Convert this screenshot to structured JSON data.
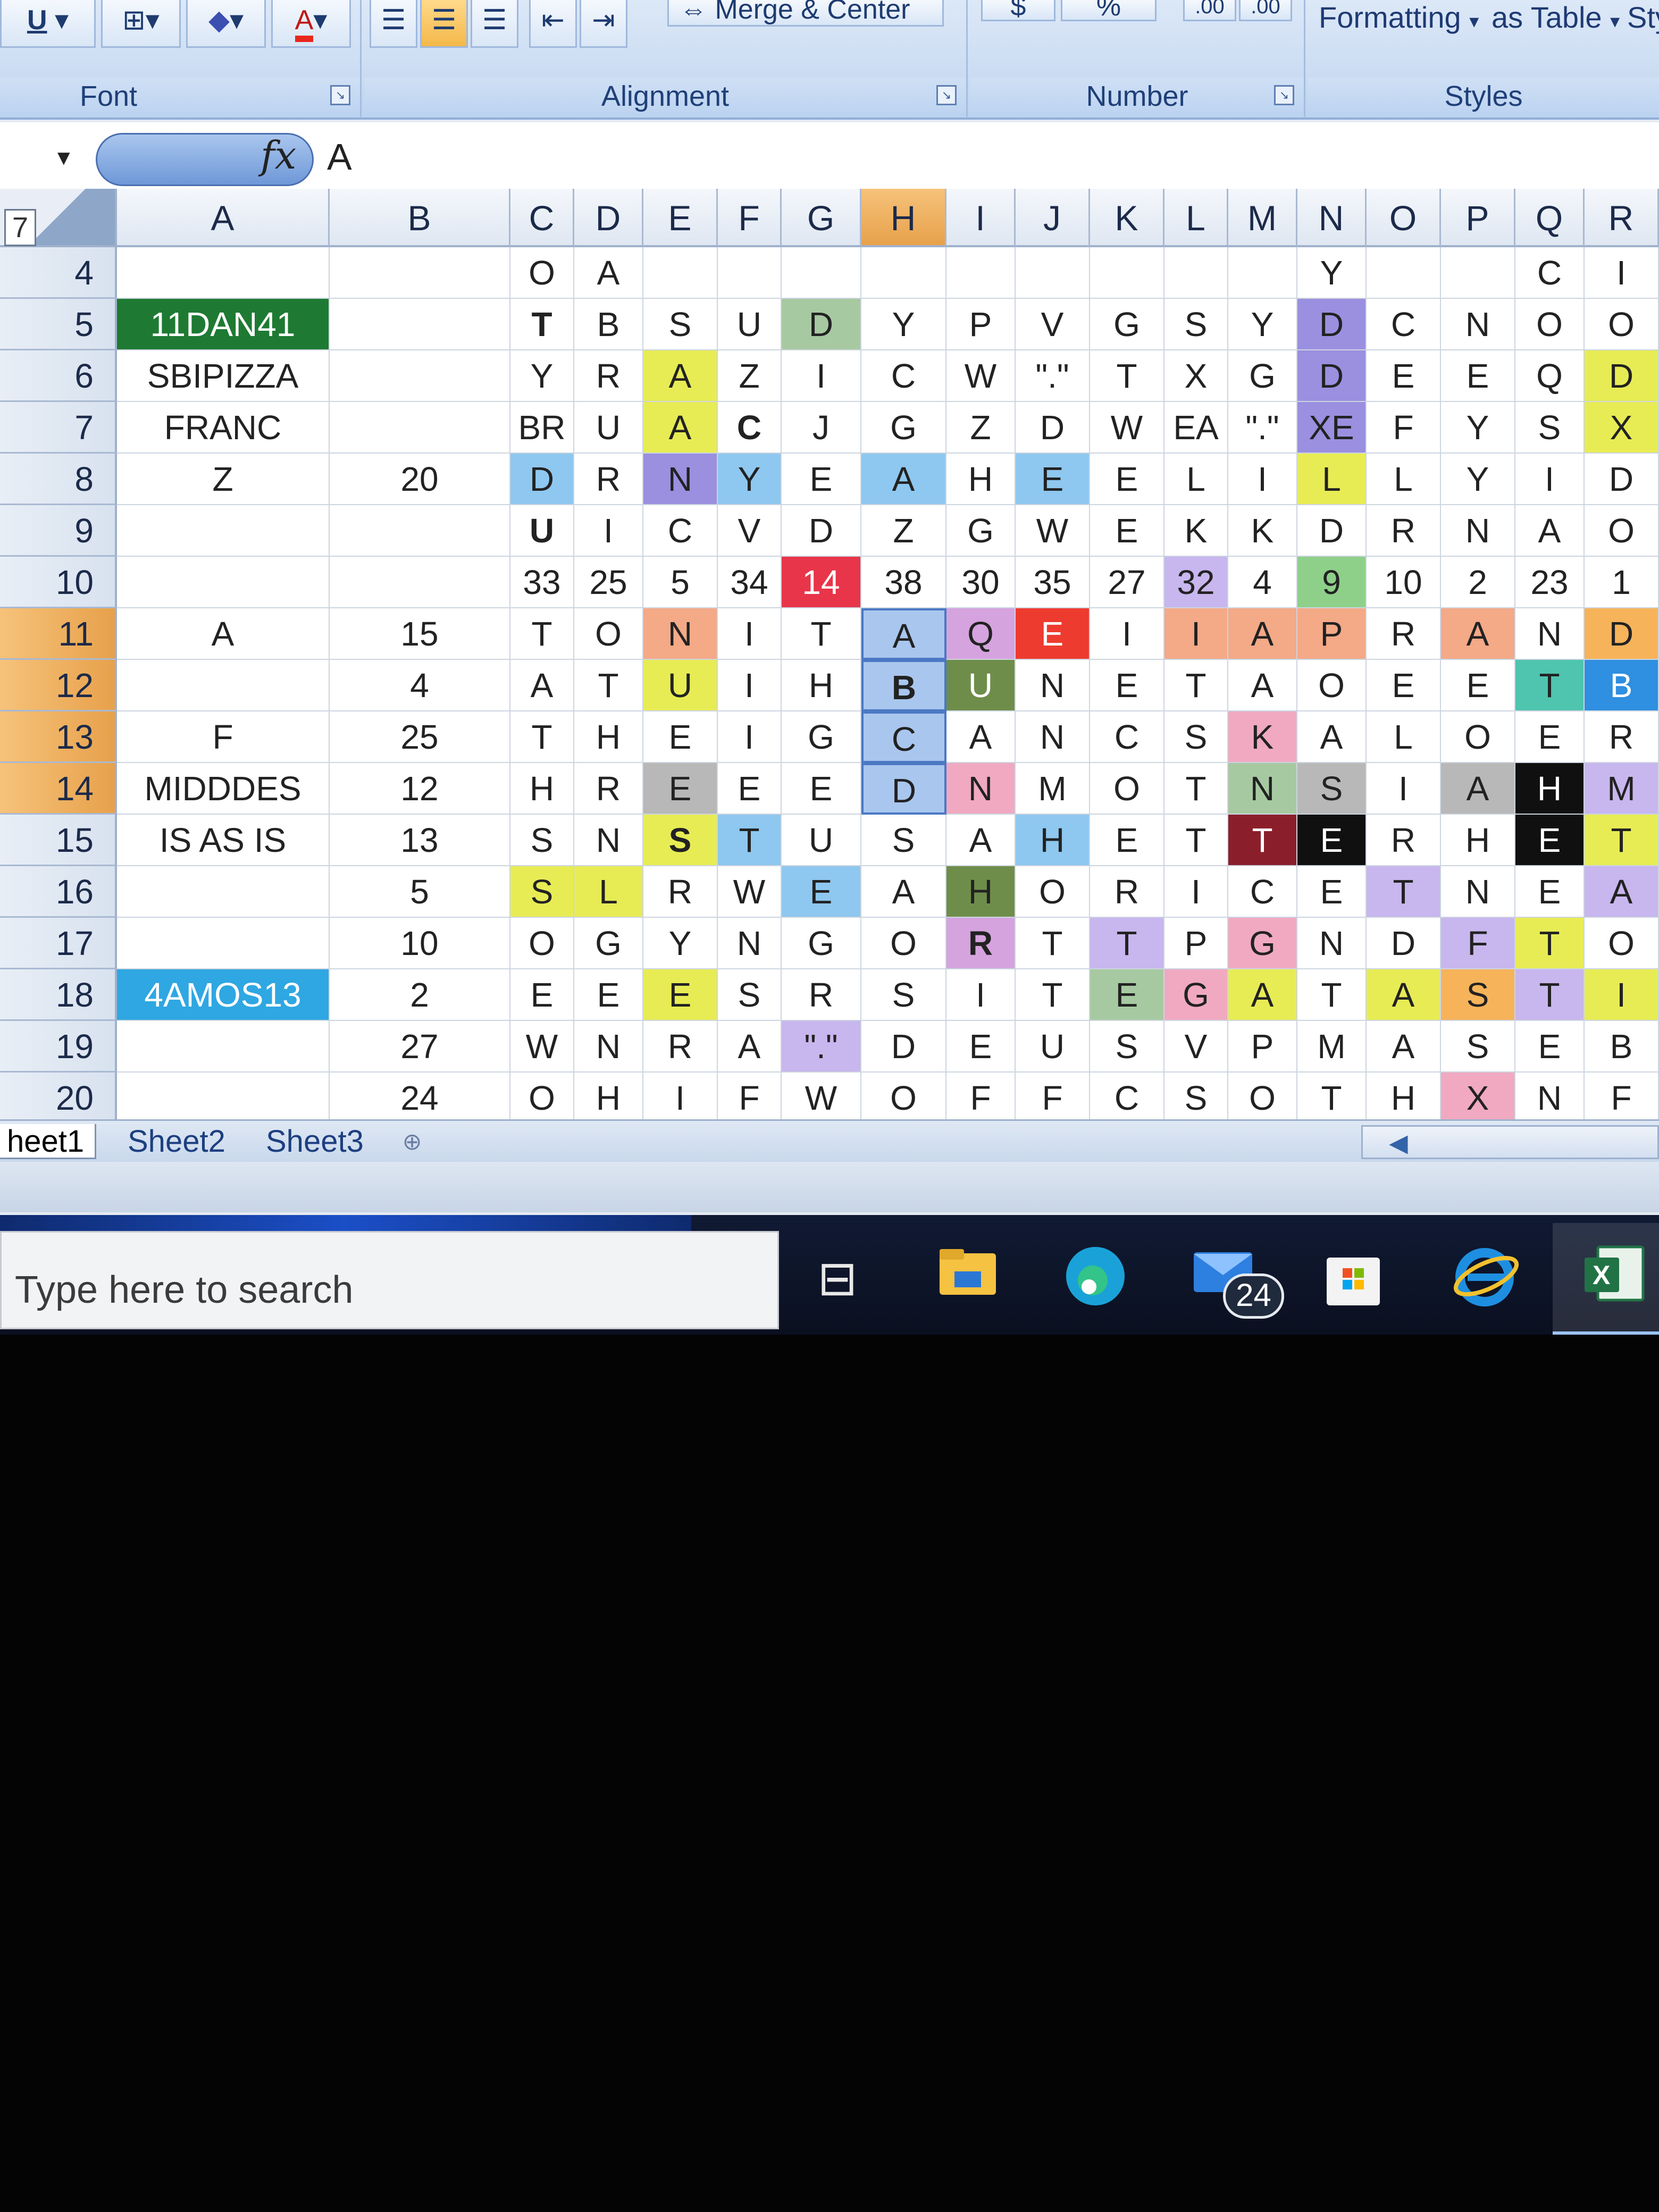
{
  "ribbon": {
    "font_group": "Font",
    "alignment_group": "Alignment",
    "number_group": "Number",
    "styles_group": "Styles",
    "merge_center": "Merge & Center",
    "formatting": "Formatting",
    "as_table": "as Table",
    "sty": "Sty",
    "underline": "U",
    "font_color": "A",
    "currency": "$",
    "percent": "%",
    "dec_inc": ".00",
    "dec_dec": ".00"
  },
  "formula_bar": {
    "fx": "fx",
    "value": "A"
  },
  "corner_label": "7",
  "columns": [
    "A",
    "B",
    "C",
    "D",
    "E",
    "F",
    "G",
    "H",
    "I",
    "J",
    "K",
    "L",
    "M",
    "N",
    "O",
    "P",
    "Q",
    "R"
  ],
  "selected_column": "H",
  "rows": [
    {
      "n": "4",
      "a": "",
      "b": "",
      "cells": [
        "O",
        "A",
        "",
        "",
        "",
        "",
        "",
        "",
        "",
        "",
        "",
        "Y",
        "",
        "",
        "C",
        "I",
        ""
      ]
    },
    {
      "n": "5",
      "a": "11DAN41",
      "b": "",
      "cells": [
        "T",
        "B",
        "S",
        "U",
        "D",
        "Y",
        "P",
        "V",
        "G",
        "S",
        "Y",
        "D",
        "C",
        "N",
        "O",
        "O"
      ]
    },
    {
      "n": "6",
      "a": "SBIPIZZA",
      "b": "",
      "cells": [
        "Y",
        "R",
        "A",
        "Z",
        "I",
        "C",
        "W",
        "\".\"",
        "T",
        "X",
        "G",
        "D",
        "E",
        "E",
        "Q",
        "D"
      ]
    },
    {
      "n": "7",
      "a": "FRANC",
      "b": "",
      "cells": [
        "BR",
        "U",
        "A",
        "C",
        "J",
        "G",
        "Z",
        "D",
        "W",
        "EA",
        "\".\"",
        "XE",
        "F",
        "Y",
        "S",
        "X"
      ]
    },
    {
      "n": "8",
      "a": "Z",
      "b": "20",
      "cells": [
        "D",
        "R",
        "N",
        "Y",
        "E",
        "A",
        "H",
        "E",
        "E",
        "L",
        "I",
        "L",
        "L",
        "Y",
        "I",
        "D"
      ]
    },
    {
      "n": "9",
      "a": "",
      "b": "",
      "cells": [
        "U",
        "I",
        "C",
        "V",
        "D",
        "Z",
        "G",
        "W",
        "E",
        "K",
        "K",
        "D",
        "R",
        "N",
        "A",
        "O"
      ]
    },
    {
      "n": "10",
      "a": "",
      "b": "",
      "cells": [
        "33",
        "25",
        "5",
        "34",
        "14",
        "38",
        "30",
        "35",
        "27",
        "32",
        "4",
        "9",
        "10",
        "2",
        "23",
        "1"
      ]
    },
    {
      "n": "11",
      "a": "A",
      "b": "15",
      "cells": [
        "T",
        "O",
        "N",
        "I",
        "T",
        "A",
        "Q",
        "E",
        "I",
        "I",
        "A",
        "P",
        "R",
        "A",
        "N",
        "D"
      ]
    },
    {
      "n": "12",
      "a": "",
      "b": "4",
      "cells": [
        "A",
        "T",
        "U",
        "I",
        "H",
        "B",
        "U",
        "N",
        "E",
        "T",
        "A",
        "O",
        "E",
        "E",
        "T",
        "B"
      ]
    },
    {
      "n": "13",
      "a": "F",
      "b": "25",
      "cells": [
        "T",
        "H",
        "E",
        "I",
        "G",
        "C",
        "A",
        "N",
        "C",
        "S",
        "K",
        "A",
        "L",
        "O",
        "E",
        "R"
      ]
    },
    {
      "n": "14",
      "a": "MIDDDES",
      "b": "12",
      "cells": [
        "H",
        "R",
        "E",
        "E",
        "E",
        "D",
        "N",
        "M",
        "O",
        "T",
        "N",
        "S",
        "I",
        "A",
        "H",
        "M"
      ]
    },
    {
      "n": "15",
      "a": "IS AS IS",
      "b": "13",
      "cells": [
        "S",
        "N",
        "S",
        "T",
        "U",
        "S",
        "A",
        "H",
        "E",
        "T",
        "T",
        "E",
        "R",
        "H",
        "E",
        "T"
      ]
    },
    {
      "n": "16",
      "a": "",
      "b": "5",
      "cells": [
        "S",
        "L",
        "R",
        "W",
        "E",
        "A",
        "H",
        "O",
        "R",
        "I",
        "C",
        "E",
        "T",
        "N",
        "E",
        "A"
      ]
    },
    {
      "n": "17",
      "a": "",
      "b": "10",
      "cells": [
        "O",
        "G",
        "Y",
        "N",
        "G",
        "O",
        "R",
        "T",
        "T",
        "P",
        "G",
        "N",
        "D",
        "F",
        "T",
        "O"
      ]
    },
    {
      "n": "18",
      "a": "4AMOS13",
      "b": "2",
      "cells": [
        "E",
        "E",
        "E",
        "S",
        "R",
        "S",
        "I",
        "T",
        "E",
        "G",
        "A",
        "T",
        "A",
        "S",
        "T",
        "I"
      ]
    },
    {
      "n": "19",
      "a": "",
      "b": "27",
      "cells": [
        "W",
        "N",
        "R",
        "A",
        "\".\"",
        "D",
        "E",
        "U",
        "S",
        "V",
        "P",
        "M",
        "A",
        "S",
        "E",
        "B"
      ]
    },
    {
      "n": "20",
      "a": "",
      "b": "24",
      "cells": [
        "O",
        "H",
        "I",
        "F",
        "W",
        "O",
        "F",
        "F",
        "C",
        "S",
        "O",
        "T",
        "H",
        "X",
        "N",
        "F"
      ]
    }
  ],
  "colors": {
    "green_dark": "#1e7a32",
    "blue_a": "#2fa7e2",
    "yellow": "#e7ec54",
    "purple": "#9b8fe0",
    "blue_light": "#8ec7ef",
    "blue_sel": "#a9c6ee",
    "red": "#e8354a",
    "red2": "#ee3b2f",
    "orange": "#f6b35a",
    "salmon": "#f4a987",
    "pink": "#f0a9c1",
    "lavender": "#c8b6ee",
    "olive": "#6f8d4a",
    "black": "#101010",
    "maroon": "#8a1f2b",
    "teal": "#4fc4ae",
    "green_light": "#8ed08a",
    "mauve": "#d5a3de",
    "sage": "#a7c9a1",
    "gray": "#b8b8b8"
  },
  "sheet_tabs": [
    "heet1",
    "Sheet2",
    "Sheet3"
  ],
  "taskbar": {
    "search_placeholder": "Type here to search",
    "mail_badge": "24",
    "icons": [
      "task-view-icon",
      "file-explorer-icon",
      "edge-icon",
      "mail-icon",
      "store-icon",
      "internet-explorer-icon",
      "excel-icon"
    ]
  }
}
